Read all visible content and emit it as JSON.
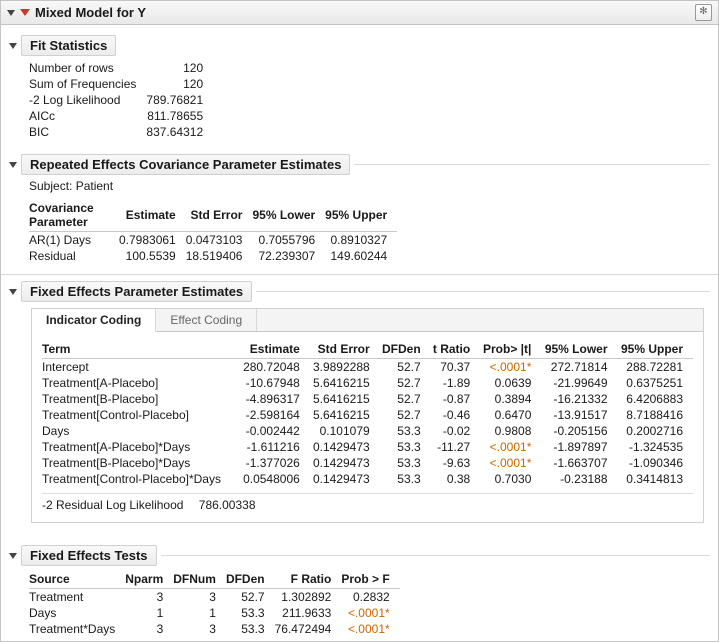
{
  "header": {
    "title": "Mixed Model for Y"
  },
  "fit": {
    "title": "Fit Statistics",
    "rows": [
      {
        "label": "Number of rows",
        "value": "120"
      },
      {
        "label": "Sum of Frequencies",
        "value": "120"
      },
      {
        "label": "-2 Log Likelihood",
        "value": "789.76821"
      },
      {
        "label": "AICc",
        "value": "811.78655"
      },
      {
        "label": "BIC",
        "value": "837.64312"
      }
    ]
  },
  "repeated": {
    "title": "Repeated Effects Covariance Parameter Estimates",
    "subject": "Subject: Patient",
    "headers": {
      "param": "Covariance Parameter",
      "est": "Estimate",
      "se": "Std Error",
      "lower": "95% Lower",
      "upper": "95% Upper"
    },
    "rows": [
      {
        "param": "AR(1) Days",
        "est": "0.7983061",
        "se": "0.0473103",
        "lower": "0.7055796",
        "upper": "0.8910327"
      },
      {
        "param": "Residual",
        "est": "100.5539",
        "se": "18.519406",
        "lower": "72.239307",
        "upper": "149.60244"
      }
    ]
  },
  "fixed_est": {
    "title": "Fixed Effects Parameter Estimates",
    "tabs": {
      "active": "Indicator Coding",
      "inactive": "Effect Coding"
    },
    "headers": {
      "term": "Term",
      "est": "Estimate",
      "se": "Std Error",
      "dfden": "DFDen",
      "tr": "t Ratio",
      "p": "Prob> |t|",
      "lower": "95% Lower",
      "upper": "95% Upper"
    },
    "rows": [
      {
        "term": "Intercept",
        "est": "280.72048",
        "se": "3.9892288",
        "dfden": "52.7",
        "tr": "70.37",
        "p": "<.0001*",
        "sig": true,
        "lower": "272.71814",
        "upper": "288.72281"
      },
      {
        "term": "Treatment[A-Placebo]",
        "est": "-10.67948",
        "se": "5.6416215",
        "dfden": "52.7",
        "tr": "-1.89",
        "p": "0.0639",
        "sig": false,
        "lower": "-21.99649",
        "upper": "0.6375251"
      },
      {
        "term": "Treatment[B-Placebo]",
        "est": "-4.896317",
        "se": "5.6416215",
        "dfden": "52.7",
        "tr": "-0.87",
        "p": "0.3894",
        "sig": false,
        "lower": "-16.21332",
        "upper": "6.4206883"
      },
      {
        "term": "Treatment[Control-Placebo]",
        "est": "-2.598164",
        "se": "5.6416215",
        "dfden": "52.7",
        "tr": "-0.46",
        "p": "0.6470",
        "sig": false,
        "lower": "-13.91517",
        "upper": "8.7188416"
      },
      {
        "term": "Days",
        "est": "-0.002442",
        "se": "0.101079",
        "dfden": "53.3",
        "tr": "-0.02",
        "p": "0.9808",
        "sig": false,
        "lower": "-0.205156",
        "upper": "0.2002716"
      },
      {
        "term": "Treatment[A-Placebo]*Days",
        "est": "-1.611216",
        "se": "0.1429473",
        "dfden": "53.3",
        "tr": "-11.27",
        "p": "<.0001*",
        "sig": true,
        "lower": "-1.897897",
        "upper": "-1.324535"
      },
      {
        "term": "Treatment[B-Placebo]*Days",
        "est": "-1.377026",
        "se": "0.1429473",
        "dfden": "53.3",
        "tr": "-9.63",
        "p": "<.0001*",
        "sig": true,
        "lower": "-1.663707",
        "upper": "-1.090346"
      },
      {
        "term": "Treatment[Control-Placebo]*Days",
        "est": "0.0548006",
        "se": "0.1429473",
        "dfden": "53.3",
        "tr": "0.38",
        "p": "0.7030",
        "sig": false,
        "lower": "-0.23188",
        "upper": "0.3414813"
      }
    ],
    "loglik": {
      "label": "-2 Residual Log Likelihood",
      "value": "786.00338"
    }
  },
  "tests": {
    "title": "Fixed Effects Tests",
    "headers": {
      "source": "Source",
      "nparm": "Nparm",
      "dfnum": "DFNum",
      "dfden": "DFDen",
      "fr": "F Ratio",
      "p": "Prob > F"
    },
    "rows": [
      {
        "source": "Treatment",
        "nparm": "3",
        "dfnum": "3",
        "dfden": "52.7",
        "fr": "1.302892",
        "p": "0.2832",
        "sig": false
      },
      {
        "source": "Days",
        "nparm": "1",
        "dfnum": "1",
        "dfden": "53.3",
        "fr": "211.9633",
        "p": "<.0001*",
        "sig": true
      },
      {
        "source": "Treatment*Days",
        "nparm": "3",
        "dfnum": "3",
        "dfden": "53.3",
        "fr": "76.472494",
        "p": "<.0001*",
        "sig": true
      }
    ]
  }
}
